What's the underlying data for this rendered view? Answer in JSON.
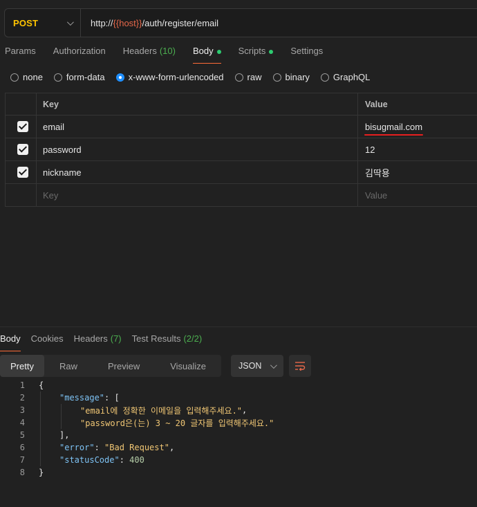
{
  "request": {
    "method": "POST",
    "url_prefix": "http://",
    "url_variable": "{{host}}",
    "url_path": "/auth/register/email"
  },
  "request_tabs": [
    {
      "label": "Params"
    },
    {
      "label": "Authorization"
    },
    {
      "label": "Headers",
      "count": "(10)"
    },
    {
      "label": "Body"
    },
    {
      "label": "Scripts"
    },
    {
      "label": "Settings"
    }
  ],
  "body_types": [
    "none",
    "form-data",
    "x-www-form-urlencoded",
    "raw",
    "binary",
    "GraphQL"
  ],
  "body_type_selected": "x-www-form-urlencoded",
  "table": {
    "headers": {
      "key": "Key",
      "value": "Value"
    },
    "rows": [
      {
        "key": "email",
        "value": "bisugmail.com"
      },
      {
        "key": "password",
        "value": "12"
      },
      {
        "key": "nickname",
        "value": "김딱용"
      }
    ],
    "placeholder": {
      "key": "Key",
      "value": "Value"
    }
  },
  "response_tabs": [
    {
      "label": "Body"
    },
    {
      "label": "Cookies"
    },
    {
      "label": "Headers",
      "count": "(7)"
    },
    {
      "label": "Test Results",
      "count": "(2/2)"
    }
  ],
  "view_modes": [
    "Pretty",
    "Raw",
    "Preview",
    "Visualize"
  ],
  "format": "JSON",
  "response_body": {
    "line_numbers": [
      "1",
      "2",
      "3",
      "4",
      "5",
      "6",
      "7",
      "8"
    ],
    "message_key": "\"message\"",
    "message_1": "\"email에 정확한 이메일을 입력해주세요.\"",
    "message_2": "\"password은(는) 3 ~ 20 글자를 입력해주세요.\"",
    "error_key": "\"error\"",
    "error_value": "\"Bad Request\"",
    "status_key": "\"statusCode\"",
    "status_value": "400"
  },
  "colors": {
    "method": "#ffc400",
    "url_variable": "#e8684a",
    "active_tab_underline": "#ff6c37",
    "count_green": "#4caf50",
    "radio_selected": "#1f8fff",
    "annotation_red": "#e81f1f"
  }
}
